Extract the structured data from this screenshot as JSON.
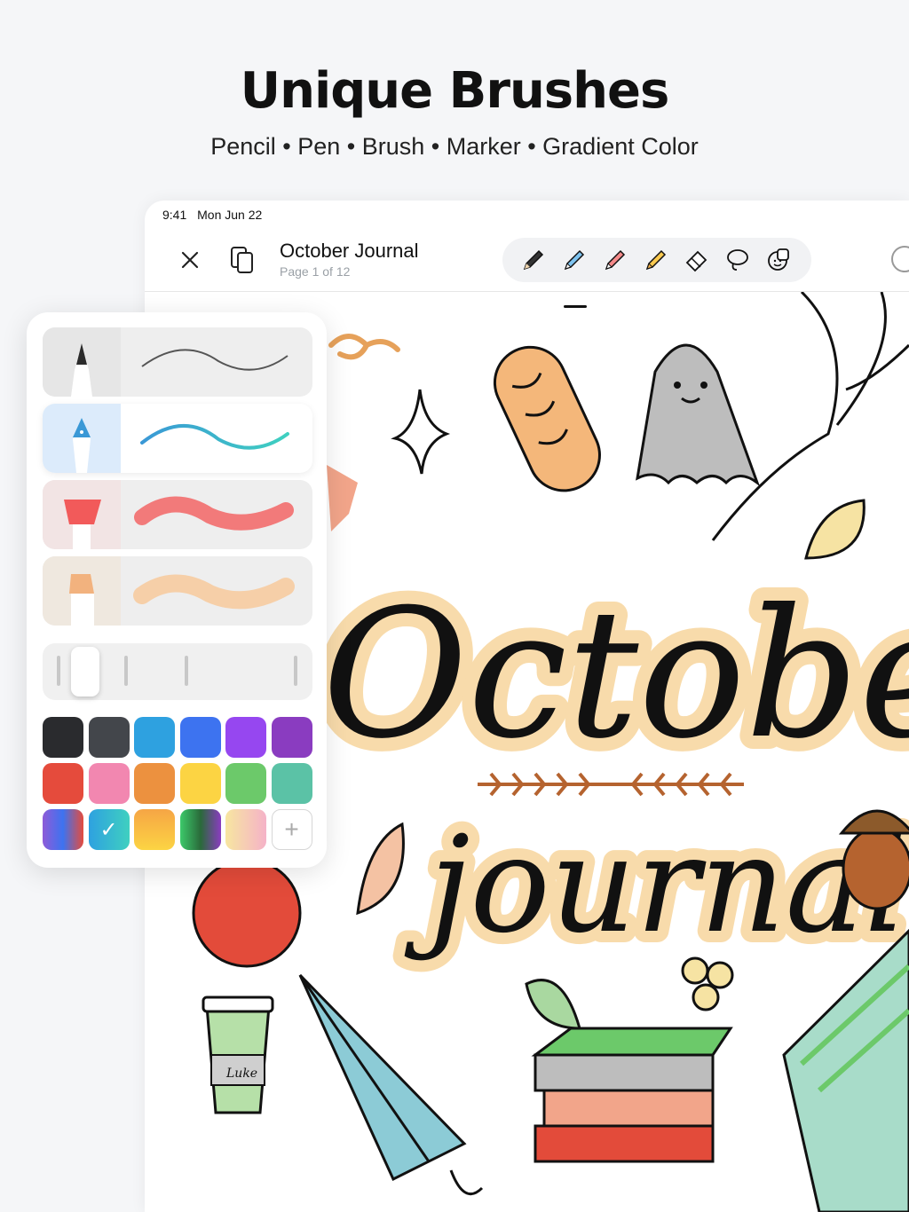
{
  "hero": {
    "title": "Unique Brushes",
    "subtitle": "Pencil • Pen • Brush • Marker • Gradient Color"
  },
  "status_bar": {
    "time": "9:41",
    "date": "Mon Jun 22"
  },
  "document": {
    "title": "October Journal",
    "page": "Page 1 of 12"
  },
  "toolbar": {
    "tools": [
      "pencil-icon",
      "pen-icon",
      "brush-icon",
      "marker-icon",
      "eraser-icon",
      "lasso-icon",
      "sticker-icon"
    ],
    "selected_tool": "pen-icon"
  },
  "brush_panel": {
    "brushes": [
      {
        "name": "pencil",
        "tip_color": "#2b2b2b",
        "stroke_color": "#555555"
      },
      {
        "name": "pen",
        "tip_color": "#3a98d6",
        "stroke_color": "#3fb3e6",
        "selected": true
      },
      {
        "name": "brush",
        "tip_color": "#f25a5a",
        "stroke_color": "#f27a7a"
      },
      {
        "name": "marker",
        "tip_color": "#f2b27e",
        "stroke_color": "#f6cfa8"
      }
    ],
    "size_level": 0.1,
    "colors": [
      [
        "#2a2b2e",
        "#43464b",
        "#2ea1e0",
        "#3d73f0",
        "#9647f0",
        "#8a3cc0"
      ],
      [
        "#e54b3c",
        "#f287b0",
        "#ec913f",
        "#fcd443",
        "#6cc96a",
        "#5bc2a6"
      ]
    ],
    "gradients": [
      "purple-blue-red",
      "cyan-teal",
      "orange-yellow",
      "green-purple",
      "pink-yellow"
    ],
    "selected_color": "cyan-teal",
    "add_label": "+"
  },
  "canvas": {
    "lettering": "October journal",
    "cup_label": "Luke"
  }
}
